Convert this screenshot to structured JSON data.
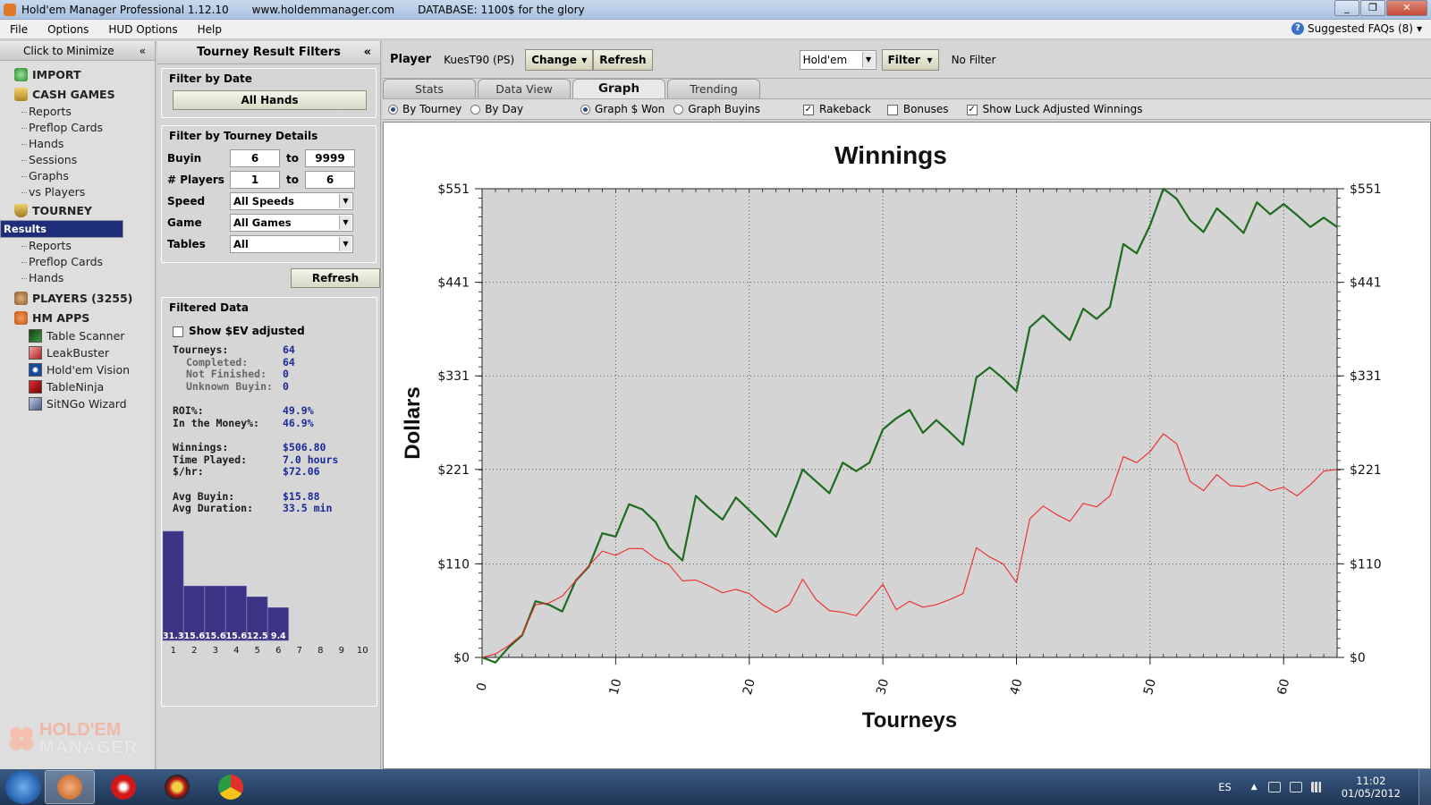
{
  "window": {
    "title": "Hold'em Manager Professional 1.12.10",
    "url": "www.holdemmanager.com",
    "database": "DATABASE: 1100$ for the glory",
    "minimize_glyph": "_",
    "restore_glyph": "❐",
    "close_glyph": "✕"
  },
  "menu": {
    "file": "File",
    "options": "Options",
    "hud_options": "HUD Options",
    "help": "Help",
    "faqs": "Suggested FAQs (8)",
    "faqs_icon": "?",
    "faqs_arrow": "▾"
  },
  "nav": {
    "minimize": "Click to Minimize",
    "collapse_glyph": "«",
    "import": "IMPORT",
    "cash_games": "CASH GAMES",
    "cash_items": [
      "Reports",
      "Preflop Cards",
      "Hands",
      "Sessions",
      "Graphs",
      "vs Players"
    ],
    "tourney": "TOURNEY",
    "tourney_items": [
      "Results",
      "Reports",
      "Preflop Cards",
      "Hands"
    ],
    "selected": "Results",
    "players": "PLAYERS (3255)",
    "hm_apps": "HM APPS",
    "apps": [
      "Table Scanner",
      "LeakBuster",
      "Hold'em Vision",
      "TableNinja",
      "SitNGo Wizard"
    ],
    "logo_line1": "HOLD'EM",
    "logo_line2": "MANAGER"
  },
  "filters": {
    "header": "Tourney Result Filters",
    "collapse_glyph": "«",
    "filter_by_date": "Filter by Date",
    "all_hands": "All Hands",
    "filter_by_details": "Filter by Tourney Details",
    "buyin_label": "Buyin",
    "buyin_from": "6",
    "buyin_to": "9999",
    "players_label": "# Players",
    "players_from": "1",
    "players_to": "6",
    "to": "to",
    "speed_label": "Speed",
    "speed_value": "All Speeds",
    "game_label": "Game",
    "game_value": "All Games",
    "tables_label": "Tables",
    "tables_value": "All",
    "dropdown_arrow": "▼",
    "refresh": "Refresh",
    "filtered_data": "Filtered Data",
    "show_ev": "Show $EV adjusted",
    "stats": {
      "tourneys_k": "Tourneys:",
      "tourneys_v": "64",
      "completed_k": "Completed:",
      "completed_v": "64",
      "not_finished_k": "Not Finished:",
      "not_finished_v": "0",
      "unknown_k": "Unknown Buyin:",
      "unknown_v": "0",
      "roi_k": "ROI%:",
      "roi_v": "49.9%",
      "itm_k": "In the Money%:",
      "itm_v": "46.9%",
      "winnings_k": "Winnings:",
      "winnings_v": "$506.80",
      "time_k": "Time Played:",
      "time_v": "7.0 hours",
      "hr_k": "$/hr:",
      "hr_v": "$72.06",
      "avg_buyin_k": "Avg Buyin:",
      "avg_buyin_v": "$15.88",
      "avg_dur_k": "Avg Duration:",
      "avg_dur_v": "33.5 min"
    },
    "histogram": {
      "positions": [
        "1",
        "2",
        "3",
        "4",
        "5",
        "6",
        "7",
        "8",
        "9",
        "10"
      ],
      "values": [
        31.3,
        15.6,
        15.6,
        15.6,
        12.5,
        9.4,
        0,
        0,
        0,
        0
      ],
      "labels": [
        "31.3",
        "15.6",
        "15.6",
        "15.6",
        "12.5",
        "9.4",
        "",
        "",
        "",
        ""
      ],
      "color": "#3b3484"
    }
  },
  "main": {
    "player_label": "Player",
    "player_name": "KuesT90 (PS)",
    "change": "Change",
    "refresh": "Refresh",
    "game_select": "Hold'em",
    "filter": "Filter",
    "no_filter": "No Filter",
    "dropdown_arrow": "▾",
    "tabs": [
      "Stats",
      "Data View",
      "Graph",
      "Trending"
    ],
    "active_tab": "Graph",
    "by_tourney": "By Tourney",
    "by_day": "By Day",
    "graph_won": "Graph $ Won",
    "graph_buyins": "Graph Buyins",
    "rakeback": "Rakeback",
    "bonuses": "Bonuses",
    "show_luck": "Show Luck Adjusted Winnings",
    "check_glyph": "✓"
  },
  "chart_data": {
    "type": "line",
    "title": "Winnings",
    "xlabel": "Tourneys",
    "ylabel": "Dollars",
    "xlim": [
      0,
      64
    ],
    "ylim": [
      0,
      551
    ],
    "x_ticks": [
      "0",
      "10",
      "20",
      "30",
      "40",
      "50",
      "60"
    ],
    "y_ticks": [
      "$0",
      "$110",
      "$221",
      "$331",
      "$441",
      "$551"
    ],
    "y_tick_values": [
      0,
      110,
      221,
      331,
      441,
      551
    ],
    "grid": true,
    "colors": {
      "series1": "#1f6b1f",
      "series2": "#ee2a2a",
      "plot_bg": "#d4d4d4"
    },
    "series": [
      {
        "values": [
          0,
          -6,
          12,
          26,
          66,
          62,
          54,
          90,
          107,
          146,
          142,
          180,
          174,
          159,
          129,
          114,
          190,
          175,
          162,
          188,
          173,
          158,
          142,
          180,
          221,
          207,
          193,
          229,
          219,
          229,
          268,
          281,
          291,
          264,
          279,
          265,
          250,
          329,
          341,
          328,
          313,
          388,
          402,
          387,
          373,
          410,
          398,
          412,
          486,
          475,
          508,
          551,
          539,
          514,
          500,
          528,
          514,
          499,
          535,
          521,
          533,
          520,
          506,
          517,
          506
        ]
      },
      {
        "values": [
          0,
          4,
          14,
          27,
          62,
          64,
          72,
          90,
          108,
          125,
          120,
          128,
          128,
          116,
          109,
          90,
          91,
          84,
          76,
          80,
          75,
          62,
          53,
          62,
          92,
          68,
          55,
          53,
          49,
          67,
          86,
          56,
          66,
          59,
          62,
          68,
          75,
          129,
          118,
          110,
          88,
          163,
          178,
          168,
          160,
          181,
          177,
          190,
          236,
          229,
          242,
          263,
          251,
          207,
          196,
          215,
          202,
          201,
          206,
          196,
          200,
          190,
          203,
          219,
          221
        ]
      }
    ]
  },
  "taskbar": {
    "lang": "ES",
    "time": "11:02",
    "date": "01/05/2012",
    "tray_arrow": "▲"
  }
}
